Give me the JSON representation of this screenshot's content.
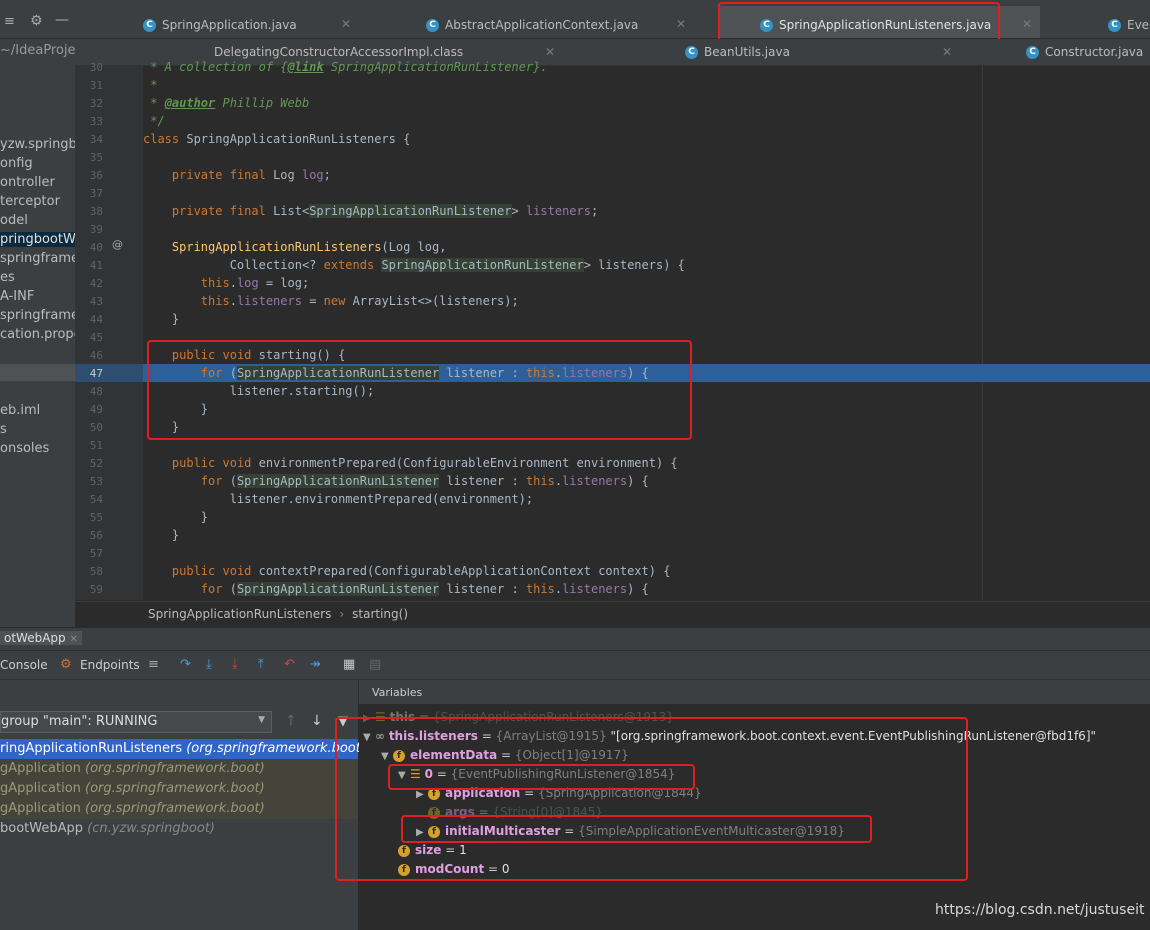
{
  "top_tabs": [
    {
      "label": "SpringApplication.java",
      "icon": "class-icon"
    },
    {
      "label": "AbstractApplicationContext.java",
      "icon": "class-icon"
    },
    {
      "label": "SpringApplicationRunListeners.java",
      "icon": "class-icon",
      "active": true
    },
    {
      "label": "Ever",
      "icon": "class-icon"
    }
  ],
  "second_tabs": [
    {
      "label": "DelegatingConstructorAccessorImpl.class"
    },
    {
      "label": "BeanUtils.java"
    },
    {
      "label": "Constructor.java"
    }
  ],
  "sidebar": {
    "header": "~/IdeaProje",
    "items": [
      "yzw.springboo",
      "onfig",
      "ontroller",
      "terceptor",
      "odel",
      "pringbootWe",
      "springframew",
      "es",
      "A-INF",
      "springframew",
      "cation.prope",
      "eb.iml",
      "s",
      "onsoles"
    ]
  },
  "code_lines": [
    {
      "n": "30",
      "text": " * A collection of {@link SpringApplicationRunListener}."
    },
    {
      "n": "31",
      "text": " *"
    },
    {
      "n": "32",
      "text": " * @author Phillip Webb"
    },
    {
      "n": "33",
      "text": " */"
    },
    {
      "n": "34",
      "text": "class SpringApplicationRunListeners {"
    },
    {
      "n": "35",
      "text": ""
    },
    {
      "n": "36",
      "text": "    private final Log log;"
    },
    {
      "n": "37",
      "text": ""
    },
    {
      "n": "38",
      "text": "    private final List<SpringApplicationRunListener> listeners;"
    },
    {
      "n": "39",
      "text": ""
    },
    {
      "n": "40",
      "text": "    SpringApplicationRunListeners(Log log,"
    },
    {
      "n": "41",
      "text": "            Collection<? extends SpringApplicationRunListener> listeners) {"
    },
    {
      "n": "42",
      "text": "        this.log = log;"
    },
    {
      "n": "43",
      "text": "        this.listeners = new ArrayList<>(listeners);"
    },
    {
      "n": "44",
      "text": "    }"
    },
    {
      "n": "45",
      "text": ""
    },
    {
      "n": "46",
      "text": "    public void starting() {"
    },
    {
      "n": "47",
      "text": "        for (SpringApplicationRunListener listener : this.listeners) {"
    },
    {
      "n": "48",
      "text": "            listener.starting();"
    },
    {
      "n": "49",
      "text": "        }"
    },
    {
      "n": "50",
      "text": "    }"
    },
    {
      "n": "51",
      "text": ""
    },
    {
      "n": "52",
      "text": "    public void environmentPrepared(ConfigurableEnvironment environment) {"
    },
    {
      "n": "53",
      "text": "        for (SpringApplicationRunListener listener : this.listeners) {"
    },
    {
      "n": "54",
      "text": "            listener.environmentPrepared(environment);"
    },
    {
      "n": "55",
      "text": "        }"
    },
    {
      "n": "56",
      "text": "    }"
    },
    {
      "n": "57",
      "text": ""
    },
    {
      "n": "58",
      "text": "    public void contextPrepared(ConfigurableApplicationContext context) {"
    },
    {
      "n": "59",
      "text": "        for (SpringApplicationRunListener listener : this.listeners) {"
    }
  ],
  "current_line": "47",
  "breadcrumbs": [
    "SpringApplicationRunListeners",
    "starting()"
  ],
  "debug": {
    "title": "otWebApp",
    "console_label": "Console",
    "endpoints_label": "Endpoints",
    "thread_select": "group \"main\": RUNNING",
    "frames": [
      {
        "method": "ringApplicationRunListeners",
        "pkg": "(org.springframework.boot)",
        "selected": true
      },
      {
        "method": "gApplication",
        "pkg": "(org.springframework.boot)"
      },
      {
        "method": "gApplication",
        "pkg": "(org.springframework.boot)"
      },
      {
        "method": "gApplication",
        "pkg": "(org.springframework.boot)"
      },
      {
        "method": "bootWebApp",
        "pkg": "(cn.yzw.springboot)"
      }
    ],
    "variables_tab": "Variables",
    "variables": [
      {
        "name": "this",
        "type": "{SpringApplicationRunListeners@1913}",
        "value": ""
      },
      {
        "name": "this.listeners",
        "type": "{ArrayList@1915}",
        "value": "\"[org.springframework.boot.context.event.EventPublishingRunListener@fbd1f6]\""
      },
      {
        "name": "elementData",
        "type": "{Object[1]@1917}",
        "value": ""
      },
      {
        "name": "0",
        "type": "{EventPublishingRunListener@1854}",
        "value": ""
      },
      {
        "name": "application",
        "type": "{SpringApplication@1844}",
        "value": ""
      },
      {
        "name": "args",
        "type": "{String[0]@1845}",
        "value": ""
      },
      {
        "name": "initialMulticaster",
        "type": "{SimpleApplicationEventMulticaster@1918}",
        "value": ""
      },
      {
        "name": "size",
        "type": "",
        "value": "1"
      },
      {
        "name": "modCount",
        "type": "",
        "value": "0"
      }
    ]
  },
  "watermark": "https://blog.csdn.net/justuseit",
  "colors": {
    "accent": "#2d6099",
    "annotation_box": "#e02020",
    "keyword": "#cc7832",
    "field": "#9876aa",
    "method": "#ffc66d"
  }
}
